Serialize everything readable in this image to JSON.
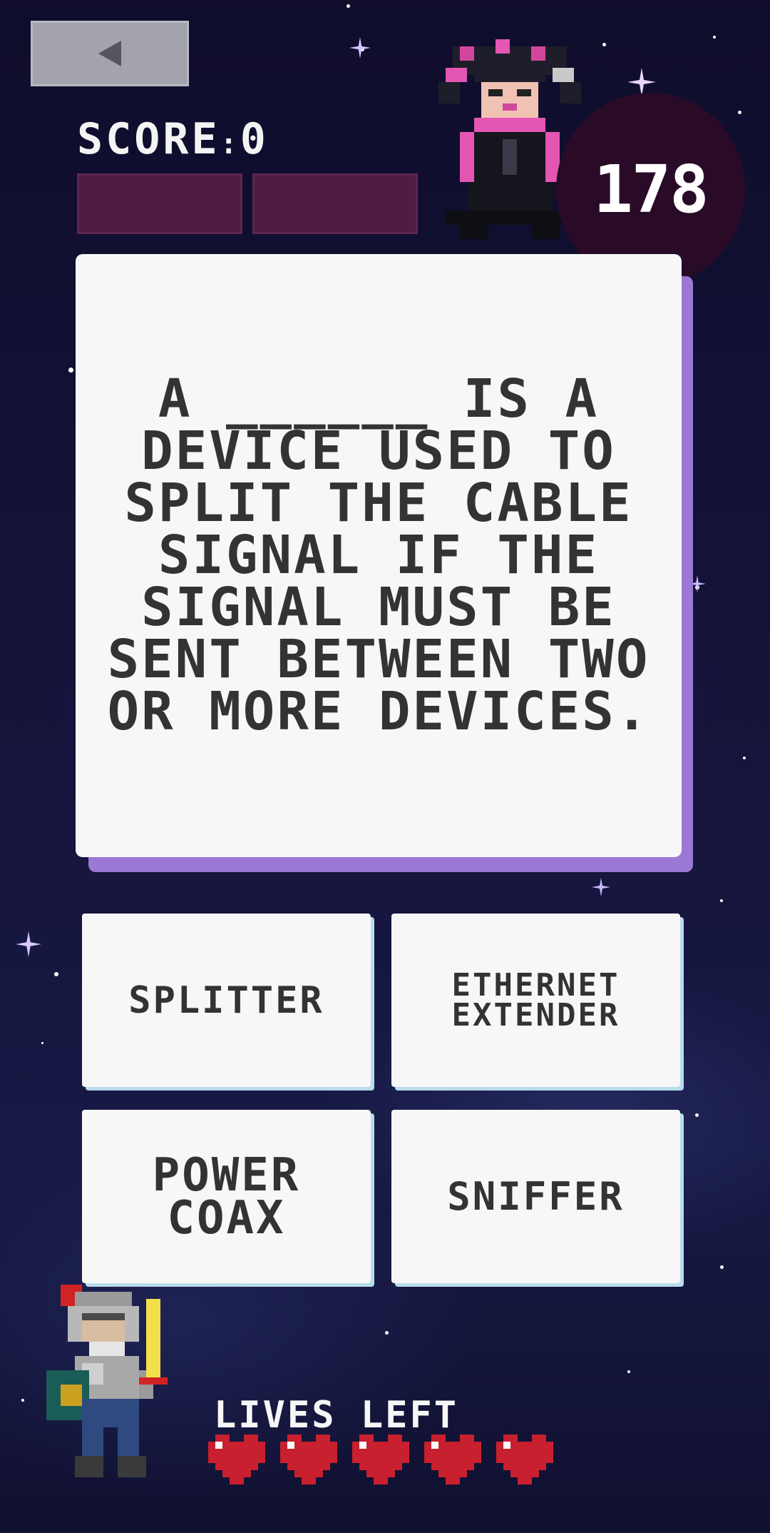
{
  "header": {
    "back_icon": "back-arrow-icon",
    "score_label": "SCORE",
    "score_value": "0",
    "timer_value": "178"
  },
  "question": {
    "text": "A ______ is a device used to split the cable signal if the signal must be sent between two or more devices."
  },
  "answers": [
    {
      "label": "SPLITTER"
    },
    {
      "label": "ETHERNET EXTENDER"
    },
    {
      "label": "POWER COAX"
    },
    {
      "label": "SNIFFER"
    }
  ],
  "lives": {
    "label": "LIVES LEFT",
    "count": 5,
    "icon": "heart-icon"
  },
  "colors": {
    "background": "#15133a",
    "card": "#f7f7f7",
    "card_shadow": "#9b78d6",
    "answer_shadow": "#b9dcec",
    "score_slot": "#4f1d44",
    "timer_bg": "#2a0b27",
    "heart": "#c8202e",
    "text_dark": "#333333"
  }
}
